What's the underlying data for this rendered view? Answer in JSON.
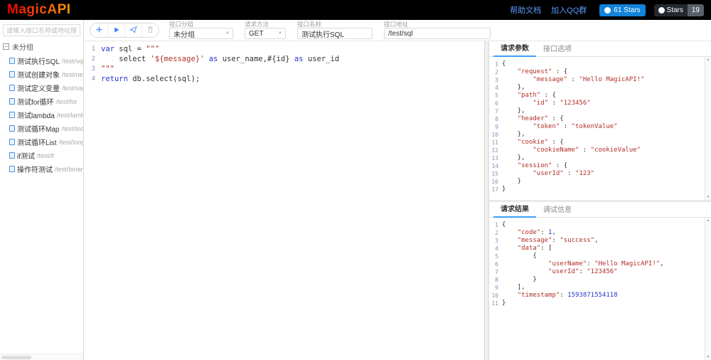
{
  "header": {
    "logo": "MagicAPI",
    "links": [
      "帮助文档",
      "加入QQ群"
    ],
    "badges": [
      {
        "icon": "github-icon",
        "label": "61 Stars"
      },
      {
        "icon": "github-icon",
        "label": "Stars",
        "count": "19"
      }
    ]
  },
  "toolbar": {
    "buttons": [
      {
        "name": "add"
      },
      {
        "name": "run"
      },
      {
        "name": "save"
      },
      {
        "name": "delete"
      }
    ],
    "fields": [
      {
        "label": "接口分组",
        "value": "未分组",
        "dropdown": true
      },
      {
        "label": "请求方法",
        "value": "GET",
        "dropdown": true
      },
      {
        "label": "接口名称",
        "value": "测试执行SQL",
        "dropdown": false
      },
      {
        "label": "接口地址",
        "value": "/test/sql",
        "dropdown": false
      }
    ]
  },
  "sidebar": {
    "search_placeholder": "请输入接口名称或地址搜索",
    "group": "未分组",
    "items": [
      {
        "name": "测试执行SQL",
        "path": "/test/sql"
      },
      {
        "name": "测试创建对象",
        "path": "/test/new"
      },
      {
        "name": "测试定义变量",
        "path": "/test/var"
      },
      {
        "name": "测试for循环",
        "path": "/test/for"
      },
      {
        "name": "测试lambda",
        "path": "/test/lambda"
      },
      {
        "name": "测试循环Map",
        "path": "/test/loop/m"
      },
      {
        "name": "测试循环List",
        "path": "/test/loop/lis"
      },
      {
        "name": "if测试",
        "path": "/test/if"
      },
      {
        "name": "操作符测试",
        "path": "/test/binary"
      }
    ]
  },
  "script_editor": {
    "lines": [
      "var sql = \"\"\"",
      "    select '${message}' as user_name,#{id} as user_id",
      "\"\"\"",
      "return db.select(sql);"
    ]
  },
  "request_panel": {
    "tabs": [
      {
        "label": "请求参数",
        "active": true
      },
      {
        "label": "接口选项",
        "active": false
      }
    ],
    "json_lines": [
      "{",
      "    \"request\" : {",
      "        \"message\" : \"Hello MagicAPI!\"",
      "    },",
      "    \"path\" : {",
      "        \"id\" : \"123456\"",
      "    },",
      "    \"header\" : {",
      "        \"token\" : \"tokenValue\"",
      "    },",
      "    \"cookie\" : {",
      "        \"cookieName\" : \"cookieValue\"",
      "    },",
      "    \"session\" : {",
      "        \"userId\" : \"123\"",
      "    }",
      "}"
    ]
  },
  "result_panel": {
    "tabs": [
      {
        "label": "请求结果",
        "active": true
      },
      {
        "label": "调试信息",
        "active": false
      }
    ],
    "json_lines": [
      "{",
      "    \"code\": 1,",
      "    \"message\": \"success\",",
      "    \"data\": [",
      "        {",
      "            \"userName\": \"Hello MagicAPI!\",",
      "            \"userId\": \"123456\"",
      "        }",
      "    ],",
      "    \"timestamp\": 1593871554118",
      "}"
    ]
  }
}
